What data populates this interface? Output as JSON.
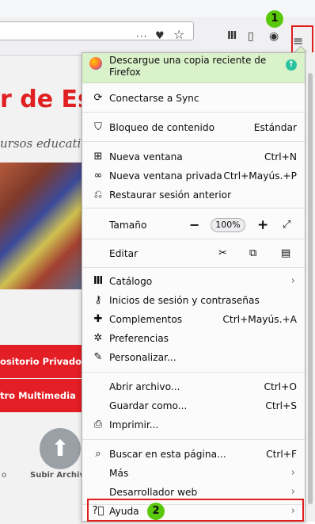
{
  "toolbar": {
    "icons": [
      {
        "name": "more-actions-icon",
        "glyph": "···"
      },
      {
        "name": "pocket-icon",
        "glyph": "♥"
      },
      {
        "name": "bookmark-star-icon",
        "glyph": "☆"
      },
      {
        "name": "library-icon",
        "glyph": "Ⅲ"
      },
      {
        "name": "sidebar-icon",
        "glyph": "▯"
      },
      {
        "name": "account-icon",
        "glyph": "◉"
      }
    ],
    "menu_button_glyph": "≡"
  },
  "callouts": {
    "first": "1",
    "second": "2"
  },
  "webpage": {
    "title": "r de Es",
    "subtitle": "ursos educativ",
    "button_private": "ositorio Privado",
    "button_multimedia": "tro Multimedia",
    "upload_label": "Subir Archivo",
    "left_label": "o"
  },
  "menu": {
    "banner": {
      "text": "Descargue una copia reciente de Firefox"
    },
    "sync": {
      "label": "Conectarse a Sync"
    },
    "content_blocking": {
      "label": "Bloqueo de contenido",
      "value": "Estándar"
    },
    "new_window": {
      "label": "Nueva ventana",
      "shortcut": "Ctrl+N"
    },
    "private_window": {
      "label": "Nueva ventana privada",
      "shortcut": "Ctrl+Mayús.+P"
    },
    "restore_session": {
      "label": "Restaurar sesión anterior"
    },
    "zoom": {
      "label": "Tamaño",
      "minus": "−",
      "value": "100%",
      "plus": "+",
      "fullscreen": "⤢"
    },
    "edit": {
      "label": "Editar",
      "cut": "✂",
      "copy": "⧉",
      "paste": "▤"
    },
    "library": {
      "label": "Catálogo"
    },
    "logins": {
      "label": "Inicios de sesión y contraseñas"
    },
    "addons": {
      "label": "Complementos",
      "shortcut": "Ctrl+Mayús.+A"
    },
    "preferences": {
      "label": "Preferencias"
    },
    "customize": {
      "label": "Personalizar..."
    },
    "open_file": {
      "label": "Abrir archivo...",
      "shortcut": "Ctrl+O"
    },
    "save_as": {
      "label": "Guardar como...",
      "shortcut": "Ctrl+S"
    },
    "print": {
      "label": "Imprimir..."
    },
    "find": {
      "label": "Buscar en esta página...",
      "shortcut": "Ctrl+F"
    },
    "more": {
      "label": "Más"
    },
    "web_developer": {
      "label": "Desarrollador web"
    },
    "help": {
      "label": "Ayuda"
    }
  },
  "colors": {
    "banner": "#d9f2c9",
    "highlight_border": "#e11d1d",
    "callout": "#5ac80a",
    "page_red": "#e31e24"
  }
}
